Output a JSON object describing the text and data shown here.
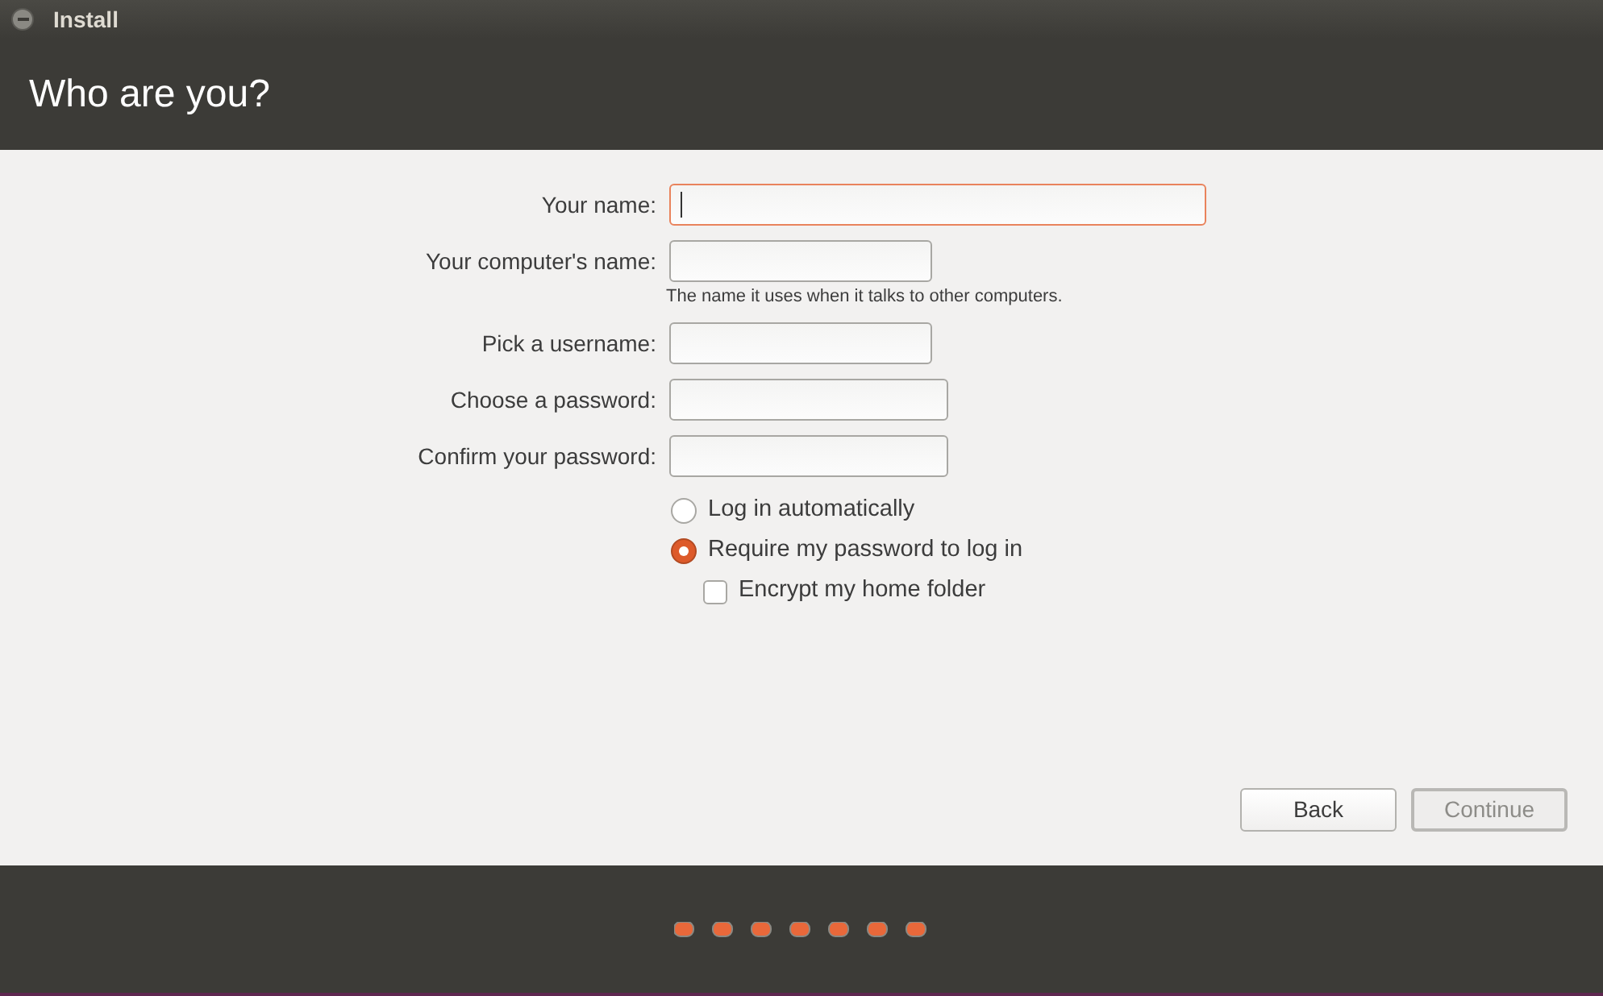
{
  "window": {
    "title": "Install"
  },
  "header": {
    "title": "Who are you?"
  },
  "fields": [
    {
      "label": "Your name:",
      "focused": true
    },
    {
      "label": "Your computer's name:",
      "focused": false,
      "hint": "The name it uses when it talks to other computers."
    },
    {
      "label": "Pick a username:",
      "focused": false
    },
    {
      "label": "Choose a password:",
      "focused": false
    },
    {
      "label": "Confirm your password:",
      "focused": false
    }
  ],
  "options": [
    {
      "kind": "radio",
      "label": "Log in automatically",
      "selected": false
    },
    {
      "kind": "radio",
      "label": "Require my password to log in",
      "selected": true
    },
    {
      "kind": "checkbox",
      "label": "Encrypt my home folder",
      "checked": false
    }
  ],
  "buttons": [
    {
      "label": "Back",
      "disabled": false
    },
    {
      "label": "Continue",
      "disabled": true
    }
  ]
}
